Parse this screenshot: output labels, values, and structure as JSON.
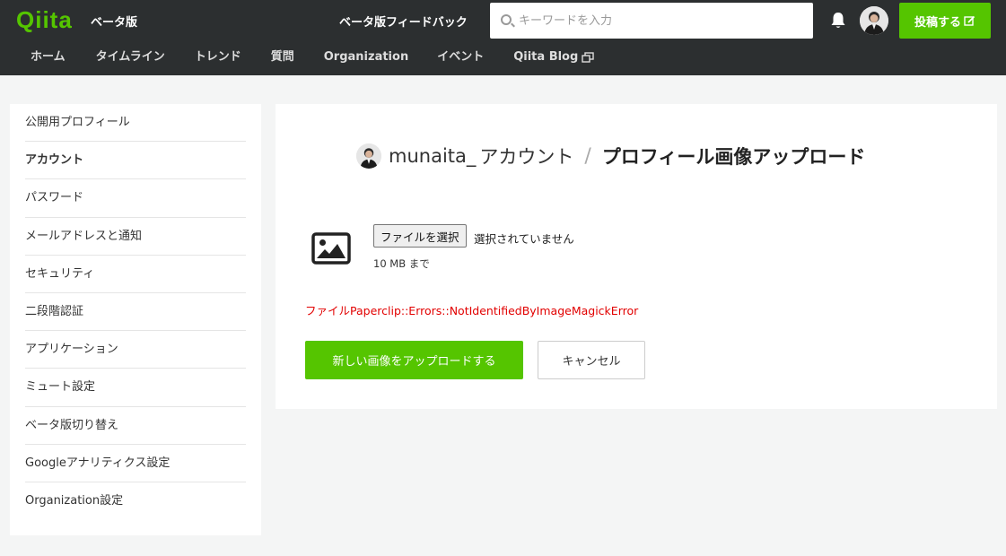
{
  "header": {
    "logo": "Qiita",
    "beta_label": "ベータ版",
    "feedback_label": "ベータ版フィードバック",
    "search_placeholder": "キーワードを入力",
    "post_label": "投稿する",
    "nav": [
      "ホーム",
      "タイムライン",
      "トレンド",
      "質問",
      "Organization",
      "イベント",
      "Qiita Blog"
    ]
  },
  "sidebar": {
    "items": [
      "公開用プロフィール",
      "アカウント",
      "パスワード",
      "メールアドレスと通知",
      "セキュリティ",
      "二段階認証",
      "アプリケーション",
      "ミュート設定",
      "ベータ版切り替え",
      "Googleアナリティクス設定",
      "Organization設定"
    ],
    "active": "アカウント"
  },
  "main": {
    "username": "munaita_",
    "account_label": "アカウント",
    "separator": "/",
    "page_title": "プロフィール画像アップロード",
    "file_button": "ファイルを選択",
    "file_status": "選択されていません",
    "size_limit": "10 MB まで",
    "error": "ファイルPaperclip::Errors::NotIdentifiedByImageMagickError",
    "upload_button": "新しい画像をアップロードする",
    "cancel_button": "キャンセル"
  },
  "colors": {
    "brand": "#55c500",
    "header_bg": "#2c2f30",
    "error": "#e20000"
  },
  "icons": [
    "search-icon",
    "bell-icon",
    "avatar",
    "edit-icon",
    "external-link-icon",
    "image-icon"
  ]
}
